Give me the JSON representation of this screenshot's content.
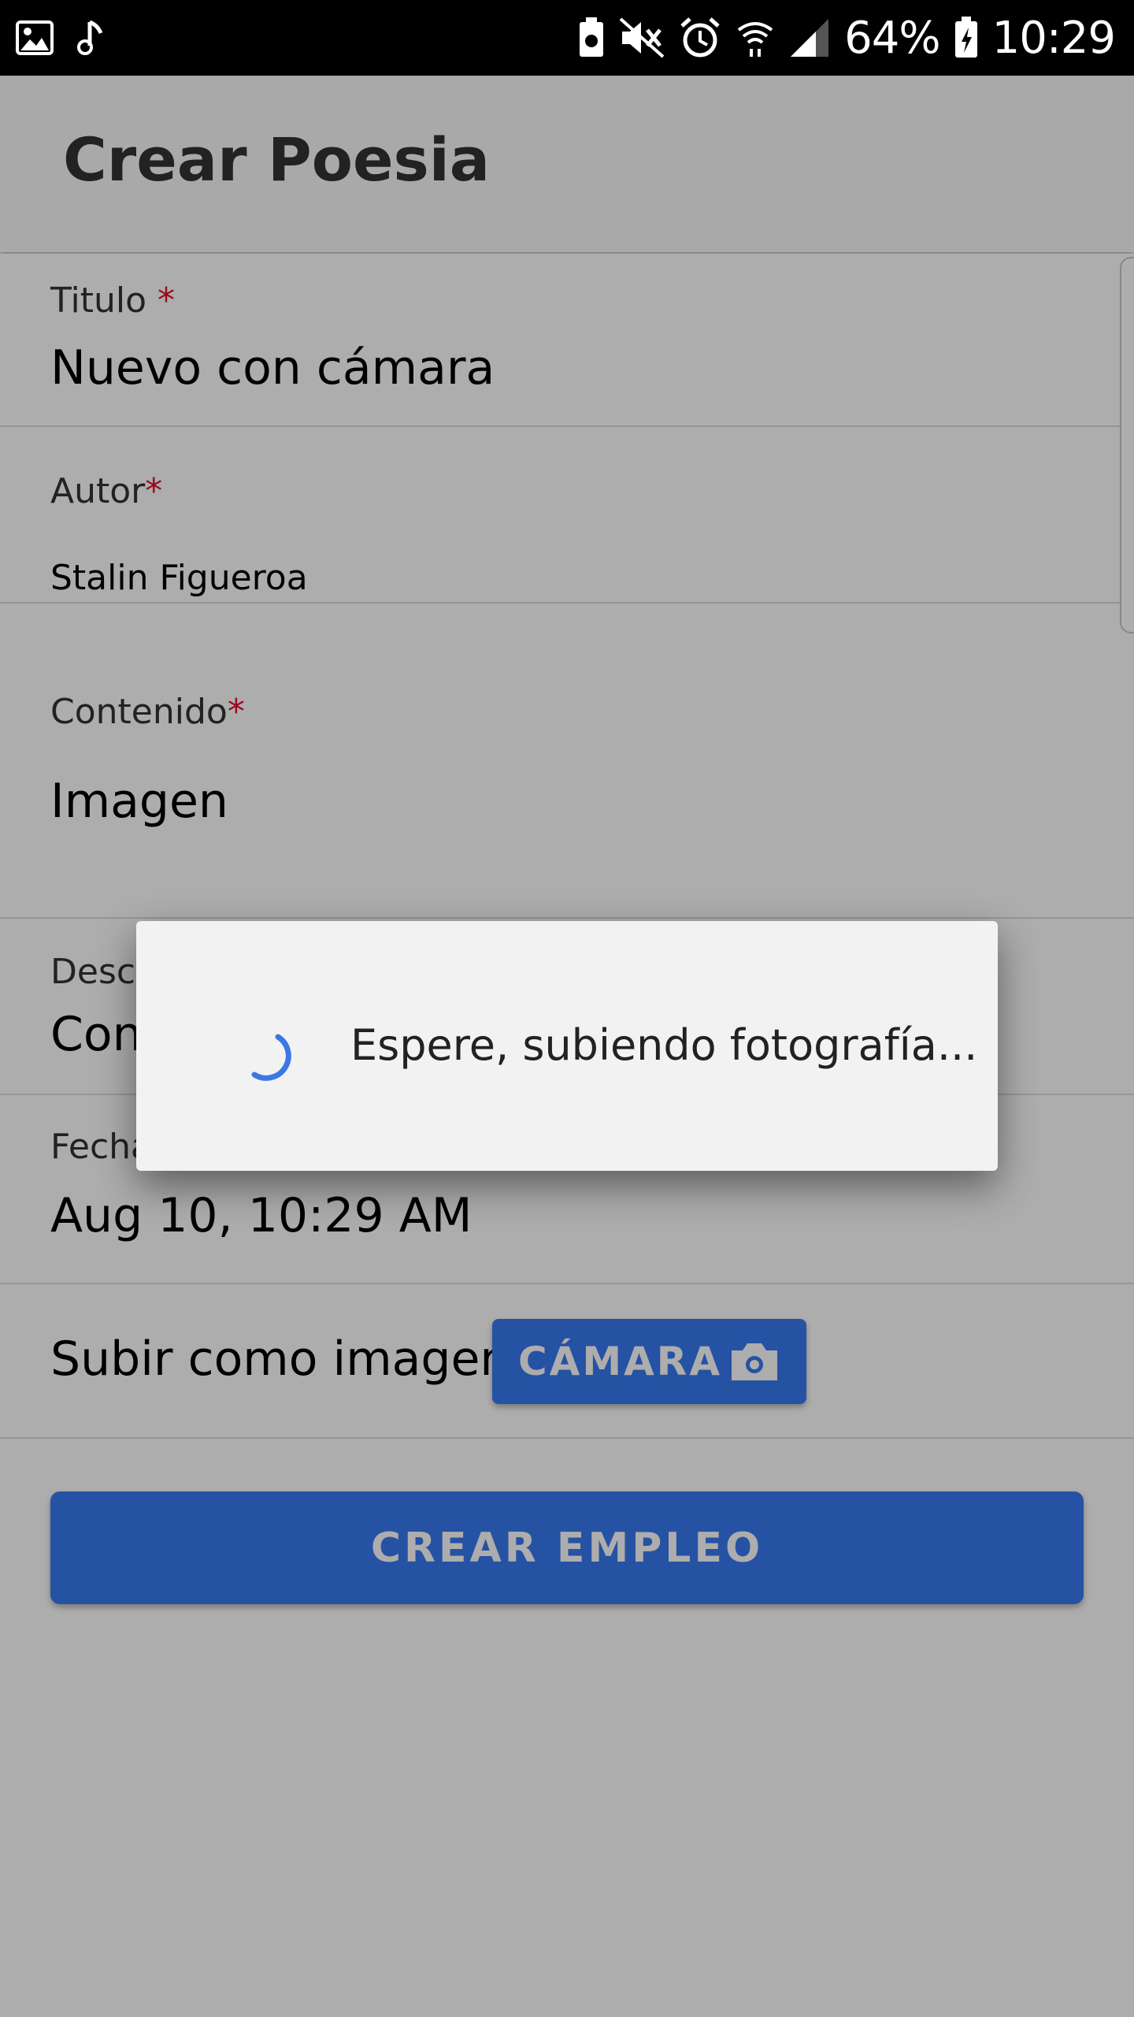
{
  "status_bar": {
    "battery": "64%",
    "time": "10:29",
    "icons": [
      "image-icon",
      "music-note-icon",
      "battery-saver-icon",
      "mute-icon",
      "alarm-icon",
      "wifi-icon",
      "signal-icon",
      "battery-charging-icon"
    ]
  },
  "app_bar": {
    "title": "Crear Poesia"
  },
  "form": {
    "titulo": {
      "label": "Titulo ",
      "required_mark": "*",
      "value": "Nuevo con cámara"
    },
    "autor": {
      "label": "Autor",
      "required_mark": "*",
      "value": "Stalin Figueroa"
    },
    "contenido": {
      "label": "Contenido",
      "required_mark": "*",
      "value": "Imagen"
    },
    "descripcion": {
      "label": "Desc",
      "value": "Con"
    },
    "fecha": {
      "label": "Fecha",
      "value": "Aug 10, 10:29 AM"
    },
    "upload": {
      "label": "Subir como imagen",
      "camera_button": "CÁMARA"
    },
    "submit": {
      "label": "CREAR EMPLEO"
    }
  },
  "dialog": {
    "message": "Espere, subiendo fotografía..."
  },
  "colors": {
    "primary": "#3879f2",
    "required": "#e0102a",
    "spinner": "#3b78e7"
  }
}
